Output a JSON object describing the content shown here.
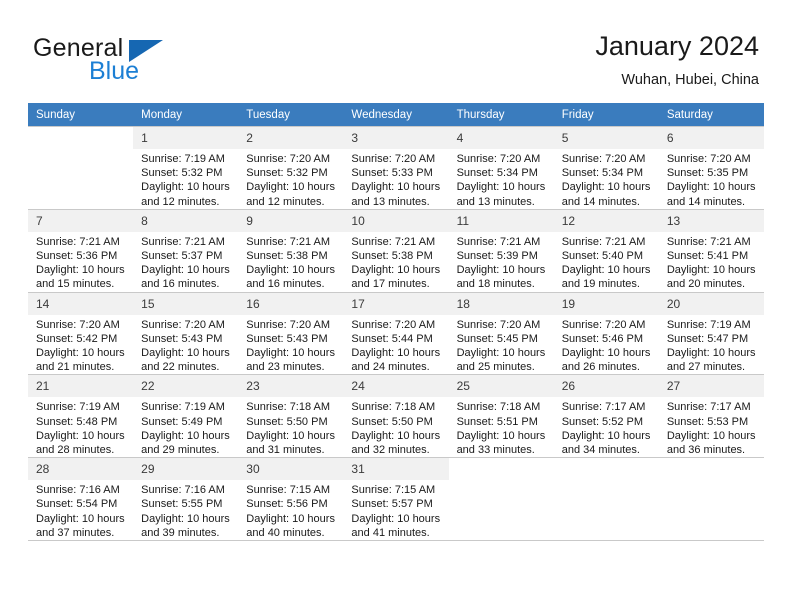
{
  "brand": {
    "name_part1": "General",
    "name_part2": "Blue",
    "logo_icon": "triangle-flag-icon"
  },
  "header": {
    "title": "January 2024",
    "location": "Wuhan, Hubei, China"
  },
  "calendar": {
    "weekday_headers": [
      "Sunday",
      "Monday",
      "Tuesday",
      "Wednesday",
      "Thursday",
      "Friday",
      "Saturday"
    ],
    "header_bg": "#3a7cbe",
    "header_text_color": "#ffffff",
    "daynum_bg": "#f1f1f1",
    "grid_line_color": "#c9c9c9",
    "weeks": [
      [
        {
          "day": "",
          "blank": true
        },
        {
          "day": "1",
          "sunrise": "Sunrise: 7:19 AM",
          "sunset": "Sunset: 5:32 PM",
          "daylight1": "Daylight: 10 hours",
          "daylight2": "and 12 minutes."
        },
        {
          "day": "2",
          "sunrise": "Sunrise: 7:20 AM",
          "sunset": "Sunset: 5:32 PM",
          "daylight1": "Daylight: 10 hours",
          "daylight2": "and 12 minutes."
        },
        {
          "day": "3",
          "sunrise": "Sunrise: 7:20 AM",
          "sunset": "Sunset: 5:33 PM",
          "daylight1": "Daylight: 10 hours",
          "daylight2": "and 13 minutes."
        },
        {
          "day": "4",
          "sunrise": "Sunrise: 7:20 AM",
          "sunset": "Sunset: 5:34 PM",
          "daylight1": "Daylight: 10 hours",
          "daylight2": "and 13 minutes."
        },
        {
          "day": "5",
          "sunrise": "Sunrise: 7:20 AM",
          "sunset": "Sunset: 5:34 PM",
          "daylight1": "Daylight: 10 hours",
          "daylight2": "and 14 minutes."
        },
        {
          "day": "6",
          "sunrise": "Sunrise: 7:20 AM",
          "sunset": "Sunset: 5:35 PM",
          "daylight1": "Daylight: 10 hours",
          "daylight2": "and 14 minutes."
        }
      ],
      [
        {
          "day": "7",
          "sunrise": "Sunrise: 7:21 AM",
          "sunset": "Sunset: 5:36 PM",
          "daylight1": "Daylight: 10 hours",
          "daylight2": "and 15 minutes."
        },
        {
          "day": "8",
          "sunrise": "Sunrise: 7:21 AM",
          "sunset": "Sunset: 5:37 PM",
          "daylight1": "Daylight: 10 hours",
          "daylight2": "and 16 minutes."
        },
        {
          "day": "9",
          "sunrise": "Sunrise: 7:21 AM",
          "sunset": "Sunset: 5:38 PM",
          "daylight1": "Daylight: 10 hours",
          "daylight2": "and 16 minutes."
        },
        {
          "day": "10",
          "sunrise": "Sunrise: 7:21 AM",
          "sunset": "Sunset: 5:38 PM",
          "daylight1": "Daylight: 10 hours",
          "daylight2": "and 17 minutes."
        },
        {
          "day": "11",
          "sunrise": "Sunrise: 7:21 AM",
          "sunset": "Sunset: 5:39 PM",
          "daylight1": "Daylight: 10 hours",
          "daylight2": "and 18 minutes."
        },
        {
          "day": "12",
          "sunrise": "Sunrise: 7:21 AM",
          "sunset": "Sunset: 5:40 PM",
          "daylight1": "Daylight: 10 hours",
          "daylight2": "and 19 minutes."
        },
        {
          "day": "13",
          "sunrise": "Sunrise: 7:21 AM",
          "sunset": "Sunset: 5:41 PM",
          "daylight1": "Daylight: 10 hours",
          "daylight2": "and 20 minutes."
        }
      ],
      [
        {
          "day": "14",
          "sunrise": "Sunrise: 7:20 AM",
          "sunset": "Sunset: 5:42 PM",
          "daylight1": "Daylight: 10 hours",
          "daylight2": "and 21 minutes."
        },
        {
          "day": "15",
          "sunrise": "Sunrise: 7:20 AM",
          "sunset": "Sunset: 5:43 PM",
          "daylight1": "Daylight: 10 hours",
          "daylight2": "and 22 minutes."
        },
        {
          "day": "16",
          "sunrise": "Sunrise: 7:20 AM",
          "sunset": "Sunset: 5:43 PM",
          "daylight1": "Daylight: 10 hours",
          "daylight2": "and 23 minutes."
        },
        {
          "day": "17",
          "sunrise": "Sunrise: 7:20 AM",
          "sunset": "Sunset: 5:44 PM",
          "daylight1": "Daylight: 10 hours",
          "daylight2": "and 24 minutes."
        },
        {
          "day": "18",
          "sunrise": "Sunrise: 7:20 AM",
          "sunset": "Sunset: 5:45 PM",
          "daylight1": "Daylight: 10 hours",
          "daylight2": "and 25 minutes."
        },
        {
          "day": "19",
          "sunrise": "Sunrise: 7:20 AM",
          "sunset": "Sunset: 5:46 PM",
          "daylight1": "Daylight: 10 hours",
          "daylight2": "and 26 minutes."
        },
        {
          "day": "20",
          "sunrise": "Sunrise: 7:19 AM",
          "sunset": "Sunset: 5:47 PM",
          "daylight1": "Daylight: 10 hours",
          "daylight2": "and 27 minutes."
        }
      ],
      [
        {
          "day": "21",
          "sunrise": "Sunrise: 7:19 AM",
          "sunset": "Sunset: 5:48 PM",
          "daylight1": "Daylight: 10 hours",
          "daylight2": "and 28 minutes."
        },
        {
          "day": "22",
          "sunrise": "Sunrise: 7:19 AM",
          "sunset": "Sunset: 5:49 PM",
          "daylight1": "Daylight: 10 hours",
          "daylight2": "and 29 minutes."
        },
        {
          "day": "23",
          "sunrise": "Sunrise: 7:18 AM",
          "sunset": "Sunset: 5:50 PM",
          "daylight1": "Daylight: 10 hours",
          "daylight2": "and 31 minutes."
        },
        {
          "day": "24",
          "sunrise": "Sunrise: 7:18 AM",
          "sunset": "Sunset: 5:50 PM",
          "daylight1": "Daylight: 10 hours",
          "daylight2": "and 32 minutes."
        },
        {
          "day": "25",
          "sunrise": "Sunrise: 7:18 AM",
          "sunset": "Sunset: 5:51 PM",
          "daylight1": "Daylight: 10 hours",
          "daylight2": "and 33 minutes."
        },
        {
          "day": "26",
          "sunrise": "Sunrise: 7:17 AM",
          "sunset": "Sunset: 5:52 PM",
          "daylight1": "Daylight: 10 hours",
          "daylight2": "and 34 minutes."
        },
        {
          "day": "27",
          "sunrise": "Sunrise: 7:17 AM",
          "sunset": "Sunset: 5:53 PM",
          "daylight1": "Daylight: 10 hours",
          "daylight2": "and 36 minutes."
        }
      ],
      [
        {
          "day": "28",
          "sunrise": "Sunrise: 7:16 AM",
          "sunset": "Sunset: 5:54 PM",
          "daylight1": "Daylight: 10 hours",
          "daylight2": "and 37 minutes."
        },
        {
          "day": "29",
          "sunrise": "Sunrise: 7:16 AM",
          "sunset": "Sunset: 5:55 PM",
          "daylight1": "Daylight: 10 hours",
          "daylight2": "and 39 minutes."
        },
        {
          "day": "30",
          "sunrise": "Sunrise: 7:15 AM",
          "sunset": "Sunset: 5:56 PM",
          "daylight1": "Daylight: 10 hours",
          "daylight2": "and 40 minutes."
        },
        {
          "day": "31",
          "sunrise": "Sunrise: 7:15 AM",
          "sunset": "Sunset: 5:57 PM",
          "daylight1": "Daylight: 10 hours",
          "daylight2": "and 41 minutes."
        },
        {
          "day": "",
          "blank": true
        },
        {
          "day": "",
          "blank": true
        },
        {
          "day": "",
          "blank": true
        }
      ]
    ]
  }
}
